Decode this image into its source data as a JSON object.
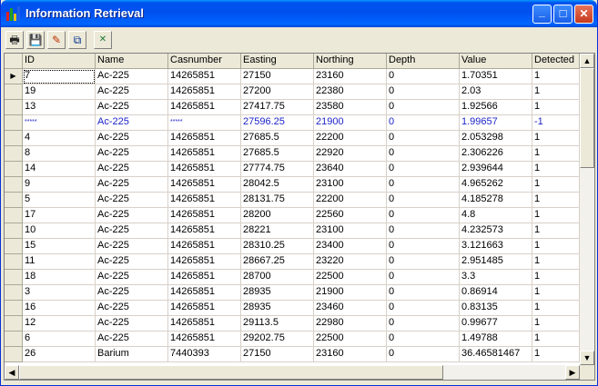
{
  "window": {
    "title": "Information Retrieval",
    "controls": {
      "minimize": "_",
      "maximize": "□",
      "close": "✕"
    }
  },
  "toolbar": {
    "buttons": [
      {
        "name": "print",
        "icon": "printer-icon",
        "glyph": "🖶"
      },
      {
        "name": "save",
        "icon": "save-icon",
        "glyph": "💾"
      },
      {
        "name": "edit",
        "icon": "pencil-icon",
        "glyph": "✎"
      },
      {
        "name": "copy",
        "icon": "copy-icon",
        "glyph": "⧉"
      },
      {
        "name": "export",
        "icon": "excel-icon",
        "glyph": "✕"
      }
    ]
  },
  "table": {
    "columns": [
      "ID",
      "Name",
      "Casnumber",
      "Easting",
      "Northing",
      "Depth",
      "Value",
      "Detected"
    ],
    "rows": [
      [
        "7",
        "Ac-225",
        "14265851",
        "27150",
        "23160",
        "0",
        "1.70351",
        "1"
      ],
      [
        "19",
        "Ac-225",
        "14265851",
        "27200",
        "22380",
        "0",
        "2.03",
        "1"
      ],
      [
        "13",
        "Ac-225",
        "14265851",
        "27417.75",
        "23580",
        "0",
        "1.92566",
        "1"
      ],
      [
        "*****",
        "Ac-225",
        "*****",
        "27596.25",
        "21900",
        "0",
        "1.99657",
        "-1"
      ],
      [
        "4",
        "Ac-225",
        "14265851",
        "27685.5",
        "22200",
        "0",
        "2.053298",
        "1"
      ],
      [
        "8",
        "Ac-225",
        "14265851",
        "27685.5",
        "22920",
        "0",
        "2.306226",
        "1"
      ],
      [
        "14",
        "Ac-225",
        "14265851",
        "27774.75",
        "23640",
        "0",
        "2.939644",
        "1"
      ],
      [
        "9",
        "Ac-225",
        "14265851",
        "28042.5",
        "23100",
        "0",
        "4.965262",
        "1"
      ],
      [
        "5",
        "Ac-225",
        "14265851",
        "28131.75",
        "22200",
        "0",
        "4.185278",
        "1"
      ],
      [
        "17",
        "Ac-225",
        "14265851",
        "28200",
        "22560",
        "0",
        "4.8",
        "1"
      ],
      [
        "10",
        "Ac-225",
        "14265851",
        "28221",
        "23100",
        "0",
        "4.232573",
        "1"
      ],
      [
        "15",
        "Ac-225",
        "14265851",
        "28310.25",
        "23400",
        "0",
        "3.121663",
        "1"
      ],
      [
        "11",
        "Ac-225",
        "14265851",
        "28667.25",
        "23220",
        "0",
        "2.951485",
        "1"
      ],
      [
        "18",
        "Ac-225",
        "14265851",
        "28700",
        "22500",
        "0",
        "3.3",
        "1"
      ],
      [
        "3",
        "Ac-225",
        "14265851",
        "28935",
        "21900",
        "0",
        "0.86914",
        "1"
      ],
      [
        "16",
        "Ac-225",
        "14265851",
        "28935",
        "23460",
        "0",
        "0.83135",
        "1"
      ],
      [
        "12",
        "Ac-225",
        "14265851",
        "29113.5",
        "22980",
        "0",
        "0.99677",
        "1"
      ],
      [
        "6",
        "Ac-225",
        "14265851",
        "29202.75",
        "22500",
        "0",
        "1.49788",
        "1"
      ],
      [
        "26",
        "Barium",
        "7440393",
        "27150",
        "23160",
        "0",
        "36.46581467",
        "1"
      ]
    ],
    "selected_row": 0,
    "highlight_row": 3,
    "highlight_color": "#1d23c8"
  }
}
